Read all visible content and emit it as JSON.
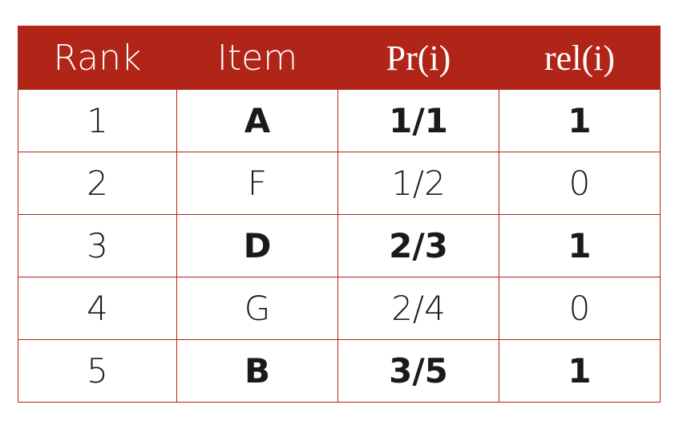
{
  "table": {
    "headers": [
      "Rank",
      "Item",
      "Pr(i)",
      "rel(i)"
    ],
    "rows": [
      {
        "rank": "1",
        "item": "A",
        "pr": "1/1",
        "rel": "1",
        "relevant": true
      },
      {
        "rank": "2",
        "item": "F",
        "pr": "1/2",
        "rel": "0",
        "relevant": false
      },
      {
        "rank": "3",
        "item": "D",
        "pr": "2/3",
        "rel": "1",
        "relevant": true
      },
      {
        "rank": "4",
        "item": "G",
        "pr": "2/4",
        "rel": "0",
        "relevant": false
      },
      {
        "rank": "5",
        "item": "B",
        "pr": "3/5",
        "rel": "1",
        "relevant": true
      }
    ]
  },
  "colors": {
    "header_bg": "#b12418",
    "border": "#b12418",
    "header_text": "#ffffff",
    "cell_text": "#1a1a1a"
  }
}
